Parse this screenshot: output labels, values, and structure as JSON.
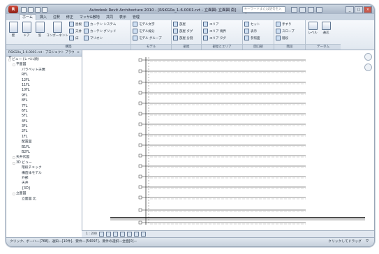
{
  "window": {
    "title": "Autodesk Revit Architecture 2010 - [RSKG0a_1-6.0001.rvt - 立面図: 立面図 南]",
    "search_placeholder": "キーワードまたは語句を入力",
    "app_button": "R",
    "controls": [
      "_",
      "□",
      "×"
    ]
  },
  "ribbon_tabs": [
    "ホーム",
    "挿入",
    "注釈",
    "修正",
    "マッサ&敷地",
    "共同",
    "表示",
    "管理"
  ],
  "ribbon": {
    "build_panel": {
      "title": "構築",
      "big_tools": [
        "壁",
        "ドア",
        "窓",
        "コンポーネント"
      ],
      "col1": [
        "屋根",
        "天井",
        "床"
      ],
      "col2": [
        "カーテン システム",
        "カーテン グリッド",
        "マリオン"
      ]
    },
    "model_panel": {
      "title": "モデル",
      "tools": [
        "モデル文字",
        "モデル線分",
        "モデル グループ"
      ]
    },
    "room_panel": {
      "title": "部屋",
      "tools": [
        "部屋",
        "部屋 タグ",
        "部屋 分割"
      ]
    },
    "area_panel": {
      "title": "部屋とエリア",
      "tools": [
        "エリア",
        "エリア 境界",
        "エリア タグ"
      ]
    },
    "opening_panel": {
      "title": "開口部",
      "tools": [
        "セット",
        "表示",
        "参照面"
      ]
    },
    "circulation_panel": {
      "title": "階段",
      "tools": [
        "手すり",
        "スロープ",
        "階段"
      ]
    },
    "datum_panel": {
      "title": "データム",
      "tools": [
        "レベル",
        "通芯"
      ]
    }
  },
  "browser": {
    "title": "RSKG0a_1-6.0001.rvt - プロジェクト ブラウザ",
    "close": "×",
    "items": [
      {
        "label": "ビュー (レベル順)",
        "toggle": "□"
      },
      {
        "label": "平面図",
        "toggle": "□"
      },
      {
        "label": "パラペット天端",
        "toggle": ""
      },
      {
        "label": "RFL",
        "toggle": ""
      },
      {
        "label": "12FL",
        "toggle": ""
      },
      {
        "label": "11FL",
        "toggle": ""
      },
      {
        "label": "10FL",
        "toggle": ""
      },
      {
        "label": "9FL",
        "toggle": ""
      },
      {
        "label": "8FL",
        "toggle": ""
      },
      {
        "label": "7FL",
        "toggle": ""
      },
      {
        "label": "6FL",
        "toggle": ""
      },
      {
        "label": "5FL",
        "toggle": ""
      },
      {
        "label": "4FL",
        "toggle": ""
      },
      {
        "label": "3FL",
        "toggle": ""
      },
      {
        "label": "2FL",
        "toggle": ""
      },
      {
        "label": "1FL",
        "toggle": ""
      },
      {
        "label": "配置図",
        "toggle": ""
      },
      {
        "label": "B1FL",
        "toggle": ""
      },
      {
        "label": "B2FL",
        "toggle": ""
      },
      {
        "label": "天井伏図",
        "toggle": "□"
      },
      {
        "label": "3D ビュー",
        "toggle": "□"
      },
      {
        "label": "階段チェック",
        "toggle": ""
      },
      {
        "label": "構造体モデル",
        "toggle": ""
      },
      {
        "label": "外部",
        "toggle": ""
      },
      {
        "label": "天井",
        "toggle": ""
      },
      {
        "label": "{3D}",
        "toggle": ""
      },
      {
        "label": "立面図",
        "toggle": "□"
      },
      {
        "label": "立面図 北",
        "toggle": ""
      }
    ]
  },
  "view": {
    "scale": "1 : 200"
  },
  "status": {
    "left": "クリック、ボーハ一[768]、通知一[10件]、要件一[54097]、要件の選択一全面[0]ー",
    "right": "クリックしてドラッグ"
  }
}
